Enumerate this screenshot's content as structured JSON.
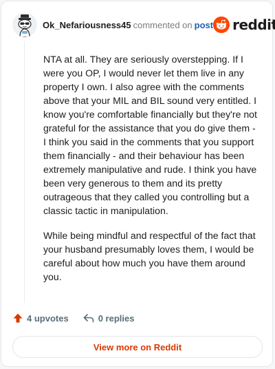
{
  "header": {
    "username": "Ok_Nefariousness45",
    "commented_on_text": "commented on",
    "post_link": "post",
    "brand_name": "reddit"
  },
  "comment": {
    "paragraphs": [
      "NTA at all. They are seriously overstepping. If I were you OP, I would never let them live in any property I own. I also agree with the comments above that your MIL and BIL sound very entitled. I know you're comfortable financially but they're not grateful for the assistance that you do give them - I think you said in the comments that you support them financially - and their behaviour has been extremely manipulative and rude. I think you have been very generous to them and its pretty outrageous that they called you controlling but a classic tactic in manipulation.",
      "While being mindful and respectful of the fact that your husband presumably loves them, I would be careful about how much you have them around you."
    ]
  },
  "actions": {
    "upvotes_label": "4 upvotes",
    "replies_label": "0 replies"
  },
  "footer": {
    "view_more_label": "View more on Reddit"
  },
  "colors": {
    "brand_orange": "#ff4500",
    "link_blue": "#1a5fb4",
    "view_more_text": "#d93900",
    "muted_text": "#576f76"
  },
  "icons": {
    "avatar": "snoo-avatar-with-hat",
    "brand": "reddit-snoo-logo",
    "upvote": "upvote-arrow-icon",
    "reply": "reply-arrow-icon"
  }
}
